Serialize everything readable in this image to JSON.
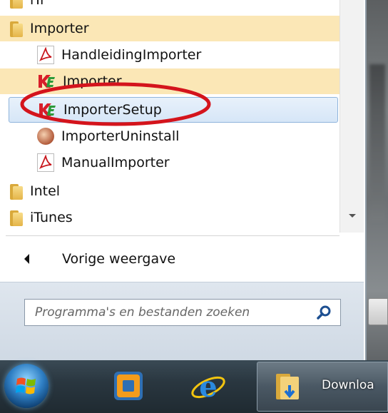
{
  "programs": {
    "items": [
      {
        "label": "iTr",
        "type": "folder",
        "icon": "folder-icon"
      },
      {
        "label": "Importer",
        "type": "folder",
        "icon": "folder-icon",
        "highlighted": true
      },
      {
        "label": "HandleidingImporter",
        "type": "file",
        "icon": "pdf-icon"
      },
      {
        "label": "Importer",
        "type": "file",
        "icon": "ke-logo-icon",
        "highlighted": true
      },
      {
        "label": "ImporterSetup",
        "type": "file",
        "icon": "ke-logo-icon",
        "selected": true
      },
      {
        "label": "ImporterUninstall",
        "type": "file",
        "icon": "uninstall-icon"
      },
      {
        "label": "ManualImporter",
        "type": "file",
        "icon": "pdf-icon"
      },
      {
        "label": "Intel",
        "type": "folder",
        "icon": "folder-icon"
      },
      {
        "label": "iTunes",
        "type": "folder",
        "icon": "folder-icon"
      }
    ]
  },
  "back": {
    "label": "Vorige weergave"
  },
  "search": {
    "placeholder": "Programma's en bestanden zoeken"
  },
  "taskbar": {
    "start_icon": "windows-orb-icon",
    "pinned": [
      "virtualbox-icon",
      "internet-explorer-icon"
    ],
    "active_window": {
      "label": "Downloa",
      "icon": "downloads-folder-icon"
    }
  },
  "colors": {
    "highlight": "#fbe7b6",
    "selected": "#d6e6f7",
    "annotation": "#d4141c",
    "taskbar": "#2a3740"
  }
}
